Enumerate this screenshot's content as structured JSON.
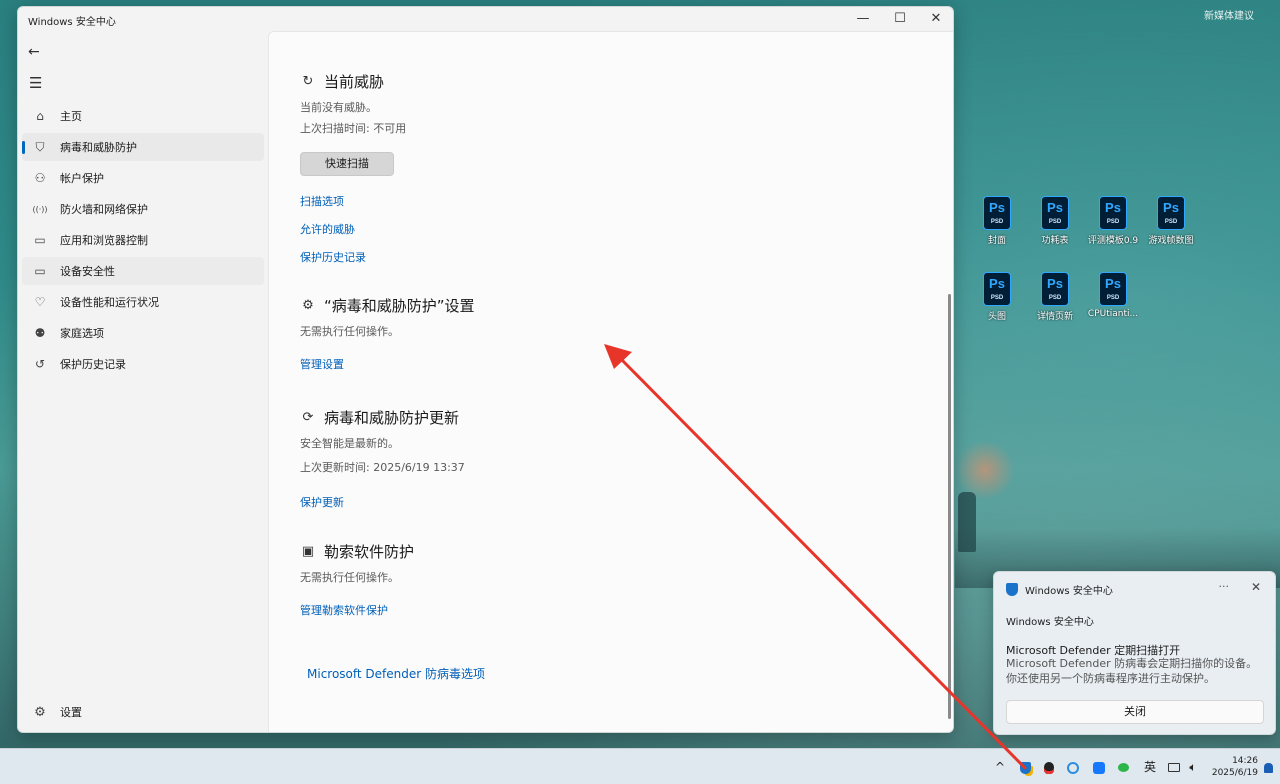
{
  "desktop": {
    "watermark": "新媒体建议",
    "icons": [
      {
        "label": "封面",
        "ps": "Ps",
        "ext": "PSD"
      },
      {
        "label": "功耗表",
        "ps": "Ps",
        "ext": "PSD"
      },
      {
        "label": "评测模板0.9",
        "ps": "Ps",
        "ext": "PSD"
      },
      {
        "label": "游戏帧数图",
        "ps": "Ps",
        "ext": "PSD"
      },
      {
        "label": "头图",
        "ps": "Ps",
        "ext": "PSD"
      },
      {
        "label": "详情页新",
        "ps": "Ps",
        "ext": "PSD"
      },
      {
        "label": "CPUtianti...",
        "ps": "Ps",
        "ext": "PSD"
      }
    ]
  },
  "window": {
    "title": "Windows 安全中心",
    "controls": {
      "minimize": "—",
      "maximize": "☐",
      "close": "✕"
    },
    "back": "←",
    "menu": "☰"
  },
  "sidebar": {
    "items": [
      {
        "icon": "⌂",
        "label": "主页"
      },
      {
        "icon": "⛉",
        "label": "病毒和威胁防护"
      },
      {
        "icon": "⚇",
        "label": "帐户保护"
      },
      {
        "icon": "((·))",
        "label": "防火墙和网络保护"
      },
      {
        "icon": "▭",
        "label": "应用和浏览器控制"
      },
      {
        "icon": "▭",
        "label": "设备安全性"
      },
      {
        "icon": "♡",
        "label": "设备性能和运行状况"
      },
      {
        "icon": "⚉",
        "label": "家庭选项"
      },
      {
        "icon": "↺",
        "label": "保护历史记录"
      }
    ],
    "settings": {
      "icon": "⚙",
      "label": "设置"
    }
  },
  "main": {
    "current_threats": {
      "icon": "↻",
      "title": "当前威胁",
      "status": "当前没有威胁。",
      "last_scan": "上次扫描时间: 不可用",
      "quick_scan": "快速扫描",
      "links": [
        "扫描选项",
        "允许的威胁",
        "保护历史记录"
      ]
    },
    "protection_settings": {
      "icon": "⚙",
      "title": "“病毒和威胁防护”设置",
      "status": "无需执行任何操作。",
      "link": "管理设置"
    },
    "updates": {
      "icon": "⟳",
      "title": "病毒和威胁防护更新",
      "status": "安全智能是最新的。",
      "last_update": "上次更新时间: 2025/6/19 13:37",
      "link": "保护更新"
    },
    "ransomware": {
      "icon": "▣",
      "title": "勒索软件防护",
      "status": "无需执行任何操作。",
      "link": "管理勒索软件保护"
    },
    "footer_link": "Microsoft Defender 防病毒选项"
  },
  "toast": {
    "app": "Windows 安全中心",
    "more": "···",
    "close": "✕",
    "app2": "Windows 安全中心",
    "heading": "Microsoft Defender 定期扫描打开",
    "body": "Microsoft Defender 防病毒会定期扫描你的设备。你还使用另一个防病毒程序进行主动保护。",
    "button": "关闭"
  },
  "taskbar": {
    "chevron": "^",
    "ime": "英",
    "time": "14:26",
    "date": "2025/6/19"
  },
  "colors": {
    "link": "#005fb8",
    "accent": "#0067c0",
    "arrow": "#e8352a"
  }
}
